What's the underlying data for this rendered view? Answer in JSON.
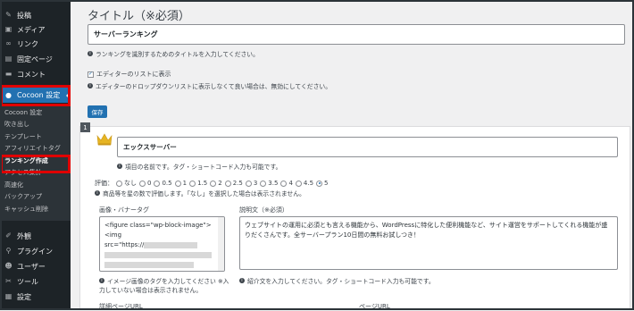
{
  "sidebar": {
    "items_top": [
      {
        "label": "投稿",
        "icon": "pin-icon"
      },
      {
        "label": "メディア",
        "icon": "media-icon"
      },
      {
        "label": "リンク",
        "icon": "link-icon"
      },
      {
        "label": "固定ページ",
        "icon": "page-icon"
      },
      {
        "label": "コメント",
        "icon": "comment-icon"
      }
    ],
    "active_item": {
      "label": "Cocoon 設定",
      "icon": "cocoon-icon"
    },
    "submenu": [
      {
        "label": "Cocoon 設定",
        "current": false
      },
      {
        "label": "吹き出し",
        "current": false
      },
      {
        "label": "テンプレート",
        "current": false
      },
      {
        "label": "アフィリエイトタグ",
        "current": false
      },
      {
        "label": "ランキング作成",
        "current": true
      },
      {
        "label": "アクセス集計",
        "current": false
      },
      {
        "label": "高速化",
        "current": false
      },
      {
        "label": "バックアップ",
        "current": false
      },
      {
        "label": "キャッシュ削除",
        "current": false
      }
    ],
    "items_bottom": [
      {
        "label": "外観",
        "icon": "appearance-icon"
      },
      {
        "label": "プラグイン",
        "icon": "plugin-icon"
      },
      {
        "label": "ユーザー",
        "icon": "user-icon"
      },
      {
        "label": "ツール",
        "icon": "tools-icon"
      },
      {
        "label": "設定",
        "icon": "settings-icon"
      }
    ]
  },
  "form": {
    "title_label": "タイトル（※必須）",
    "title_value": "サーバーランキング",
    "title_help": "ランキングを識別するためのタイトルを入力してください。",
    "editor_list_label": "エディターのリストに表示",
    "editor_list_checked": true,
    "editor_list_help": "エディターのドロップダウンリストに表示しなくて良い場合は、無効にしてください。",
    "save_label": "保存"
  },
  "item": {
    "number": "1",
    "name_value": "エックスサーバー",
    "name_help": "項目の名前です。タグ・ショートコード入力も可能です。",
    "rating_label": "評価：",
    "rating_options": [
      "なし",
      "0",
      "0.5",
      "1",
      "1.5",
      "2",
      "2.5",
      "3",
      "3.5",
      "4",
      "4.5",
      "5"
    ],
    "rating_selected": "5",
    "rating_help": "商品等を星の数で評価します。「なし」を選択した場合は表示されません。",
    "image_label": "画像・バナータグ",
    "image_code_lines": [
      "<figure class=\"wp-block-image\">",
      "<img",
      "src=\"https://"
    ],
    "image_help_1": "イメージ画像のタグを入力してください ※入",
    "image_help_2": "力していない場合は表示されません。",
    "desc_label": "説明文（※必須）",
    "desc_value": "ウェブサイトの運用に必須とも言える機能から、WordPressに特化した便利機能など、サイト運営をサポートしてくれる機能が盛りだくさんです。全サーバープラン10日間の無料お試しつき！",
    "desc_help": "紹介文を入力してください。タグ・ショートコード入力も可能です。",
    "detail_url_label": "詳細ページURL",
    "page_url_label": "ページURL"
  },
  "colors": {
    "accent": "#2271b1",
    "sidebar": "#1d2327",
    "highlight": "#e00000"
  }
}
